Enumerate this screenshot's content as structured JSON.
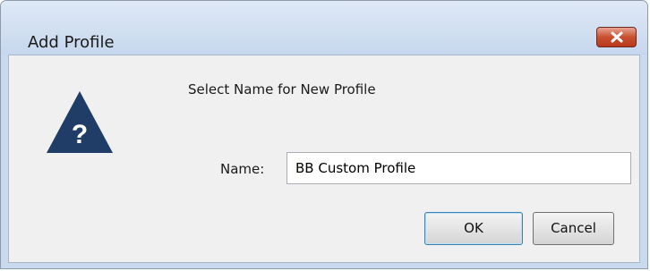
{
  "window": {
    "title": "Add Profile"
  },
  "titlebar": {
    "close_icon": "close-x-icon"
  },
  "dialog": {
    "icon": "question-mark-triangle-icon",
    "message": "Select Name for New Profile",
    "name_label": "Name:",
    "name_value": "BB Custom Profile",
    "ok_label": "OK",
    "cancel_label": "Cancel"
  },
  "colors": {
    "icon_fill": "#1f3d66",
    "close_button": "#c9502f",
    "ok_border": "#3c7fb1"
  }
}
